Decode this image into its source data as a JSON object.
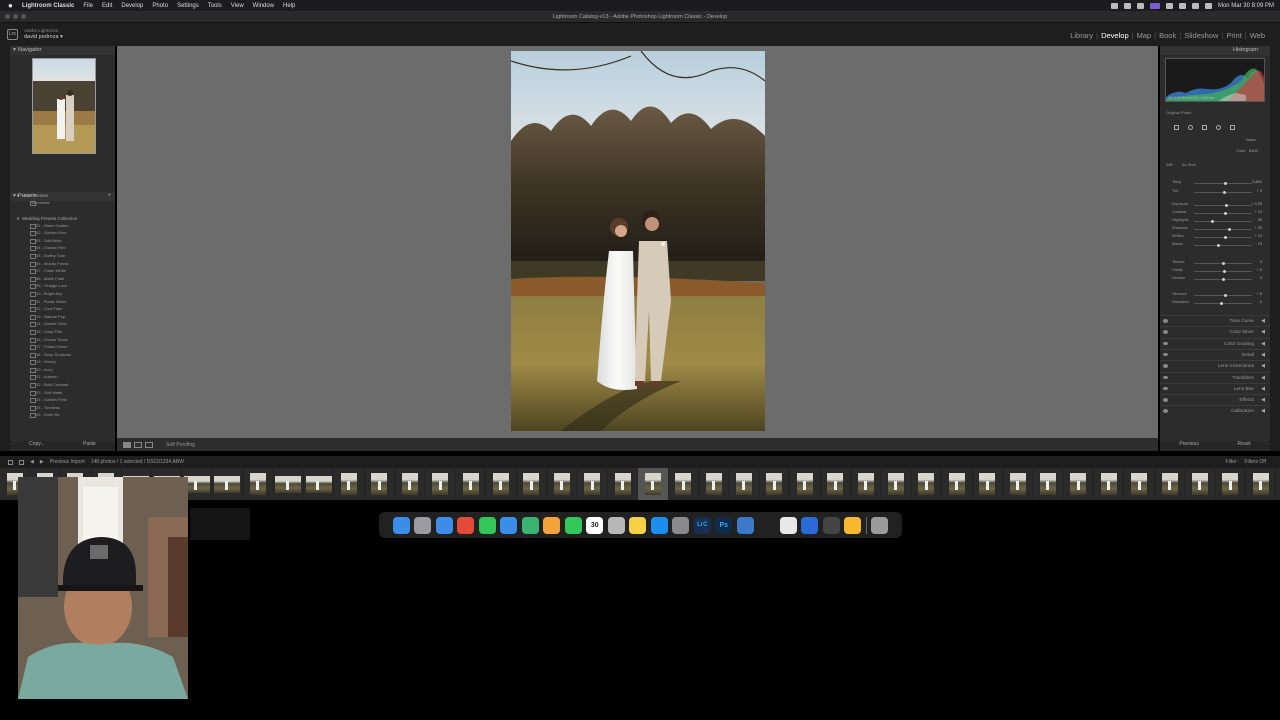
{
  "menubar": {
    "app": "Lightroom Classic",
    "items": [
      "File",
      "Edit",
      "Develop",
      "Photo",
      "Settings",
      "Tools",
      "View",
      "Window",
      "Help"
    ],
    "clock": "Mon Mar 30  8:09 PM"
  },
  "window": {
    "title": "Lightroom Catalog-v13 - Adobe Photoshop Lightroom Classic - Develop"
  },
  "identity": {
    "logo": "Lrc",
    "account": "Adobe Lightroom",
    "user": "david pedroza ▾"
  },
  "modules": [
    "Library",
    "Develop",
    "Map",
    "Book",
    "Slideshow",
    "Print",
    "Web"
  ],
  "active_module": "Develop",
  "left_panel": {
    "navigator_title": "Navigator",
    "presets_title": "Presets",
    "preset_groups": [
      "User Presets",
      "Wedding Presets Collection"
    ],
    "user_presets": [
      "No presets"
    ],
    "presets": [
      "01 - Warm Golden",
      "02 - Golden Hour",
      "03 - Soft Bride",
      "04 - Classic Film",
      "05 - Earthy Tone",
      "06 - Moody Forest",
      "07 - Clean White",
      "08 - Matte Fade",
      "09 - Vintage Love",
      "10 - Bright Airy",
      "11 - Rustic Warm",
      "12 - Cool Fade",
      "13 - Natural Pop",
      "14 - Sunset Glow",
      "15 - Crisp Film",
      "16 - Cream Tones",
      "17 - Faded Green",
      "18 - Deep Shadows",
      "19 - Honey",
      "20 - Ivory",
      "21 - Autumn",
      "22 - Bold Contrast",
      "23 - Soft Matte",
      "24 - Golden Field",
      "25 - Timeless",
      "26 - Earth Kit"
    ],
    "copy_label": "Copy...",
    "paste_label": "Paste"
  },
  "toolbar": {
    "soft_proofing": "Soft Proofing"
  },
  "right_panel": {
    "histogram_title": "Histogram",
    "histogram_readout": "ISO 100   50 mm   f/4.0   1/400 sec",
    "original_photo": "Original Photo",
    "profile_label": "Basic",
    "treatment_color": "Color",
    "treatment_bw": "B&W",
    "wb_label": "WB :",
    "wb_value": "As Shot",
    "sliders": [
      {
        "label": "Temp",
        "value": "5,800",
        "pos": 0.55
      },
      {
        "label": "Tint",
        "value": "+ 3",
        "pos": 0.52
      },
      {
        "label": "Exposure",
        "value": "+ 0.25",
        "pos": 0.56
      },
      {
        "label": "Contrast",
        "value": "+ 10",
        "pos": 0.55
      },
      {
        "label": "Highlights",
        "value": "- 35",
        "pos": 0.32
      },
      {
        "label": "Shadows",
        "value": "+ 25",
        "pos": 0.62
      },
      {
        "label": "Whites",
        "value": "+ 10",
        "pos": 0.55
      },
      {
        "label": "Blacks",
        "value": "- 15",
        "pos": 0.42
      },
      {
        "label": "Texture",
        "value": "0",
        "pos": 0.5
      },
      {
        "label": "Clarity",
        "value": "+ 5",
        "pos": 0.52
      },
      {
        "label": "Dehaze",
        "value": "0",
        "pos": 0.5
      },
      {
        "label": "Vibrance",
        "value": "+ 8",
        "pos": 0.54
      },
      {
        "label": "Saturation",
        "value": "- 5",
        "pos": 0.47
      }
    ],
    "sections": [
      "Tone Curve",
      "Color Mixer",
      "Color Grading",
      "Detail",
      "Lens Corrections",
      "Transform",
      "Lens Blur",
      "Effects",
      "Calibration"
    ],
    "previous_label": "Previous",
    "reset_label": "Reset"
  },
  "filmbar": {
    "path": "Previous Import",
    "count": "148 photos / 1 selected / DSC01234.ARW",
    "filter_label": "Filter :",
    "filter_value": "Filters Off"
  },
  "dock": {
    "apps": [
      "Finder",
      "Launchpad",
      "Safari",
      "Chrome",
      "Messages",
      "Mail",
      "Maps",
      "Photos",
      "FaceTime",
      "Calendar",
      "Contacts",
      "Notes",
      "App Store",
      "Settings",
      "Lightroom Classic",
      "Photoshop",
      "Preview",
      "CapCut",
      "Screenshot",
      "QuickTime",
      "Activity",
      "Sketch",
      "Trash"
    ],
    "calendar_day": "30"
  },
  "colors": {
    "canvas": "#6c6c6c",
    "panel": "#2c2c2c",
    "accent_violet": "#7b5cd6"
  }
}
